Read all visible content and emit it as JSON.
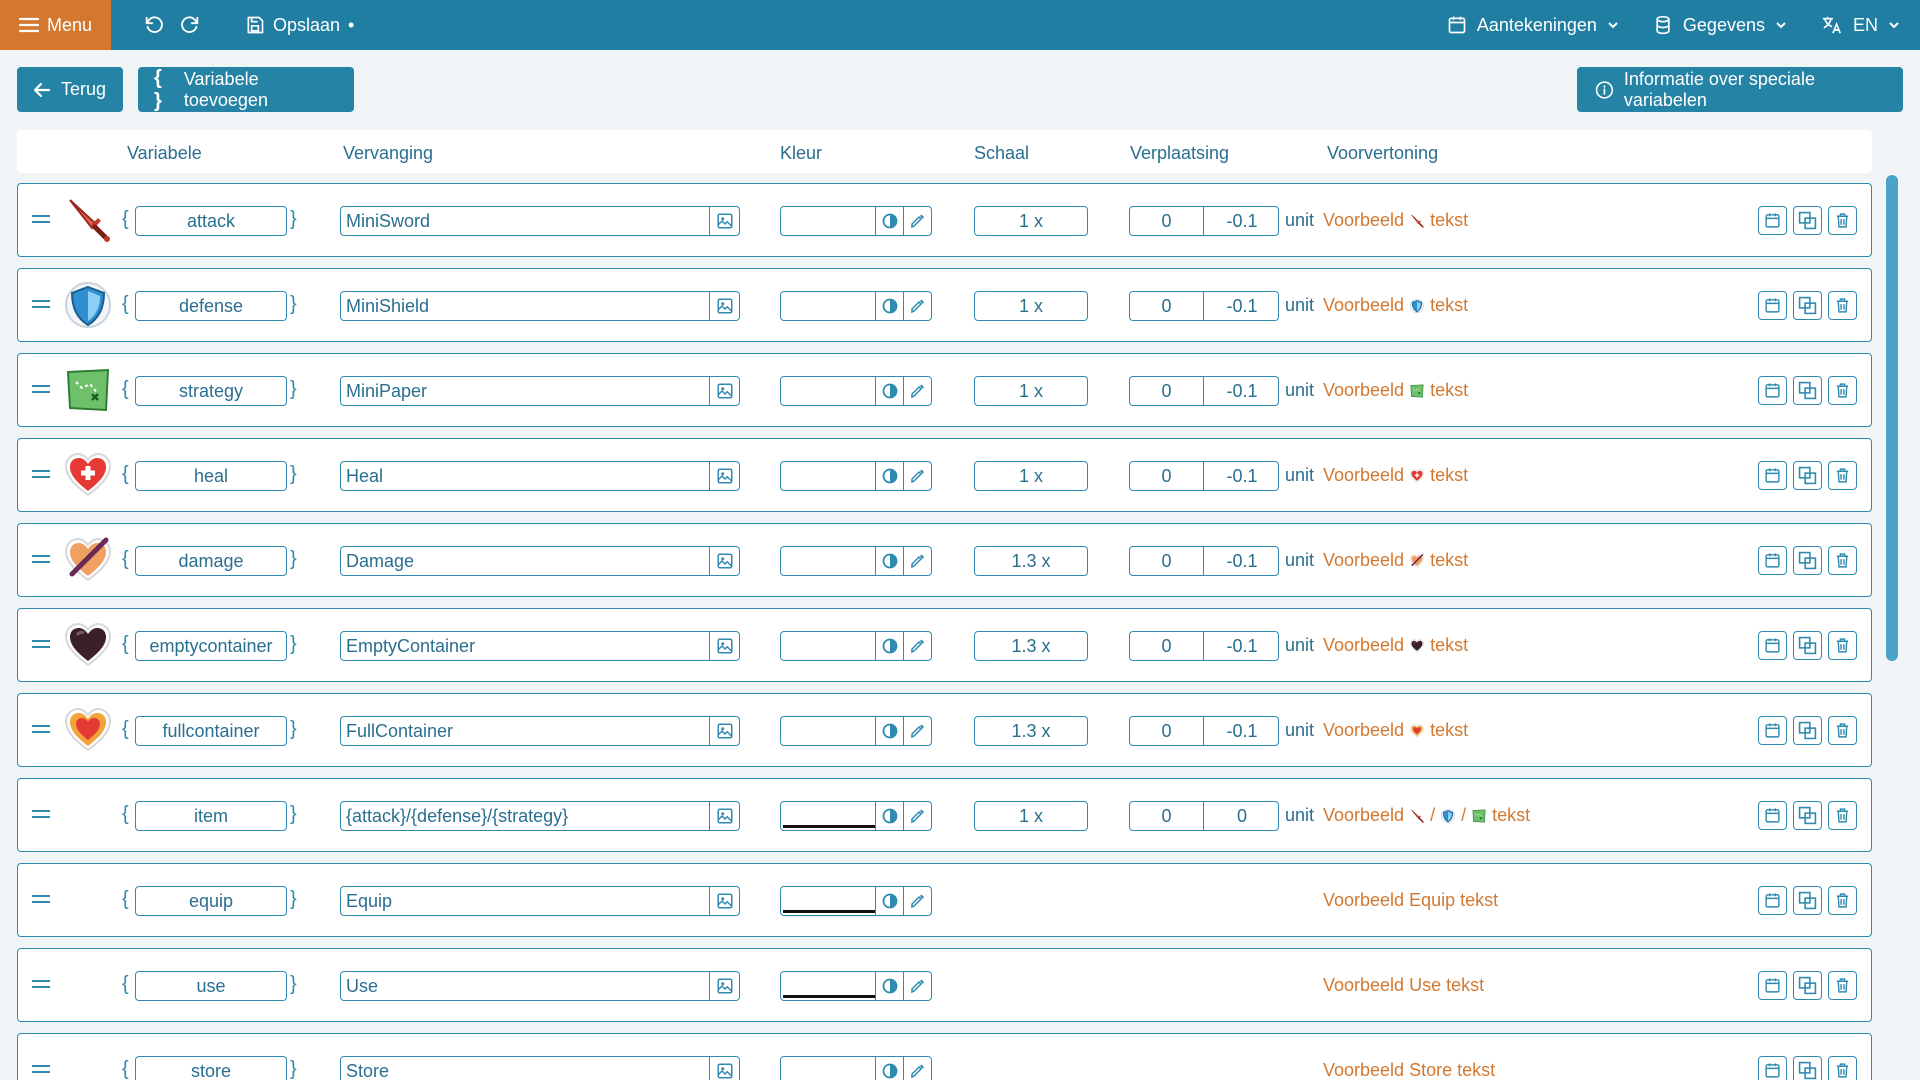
{
  "topbar": {
    "menu_label": "Menu",
    "save_label": "Opslaan",
    "unsaved_marker": "•",
    "notes_label": "Aantekeningen",
    "data_label": "Gegevens",
    "language_label": "EN"
  },
  "actions": {
    "back_label": "Terug",
    "add_label": "Variabele toevoegen",
    "info_label": "Informatie over speciale variabelen"
  },
  "columns": {
    "variable": "Variabele",
    "replacement": "Vervanging",
    "color": "Kleur",
    "scale": "Schaal",
    "offset": "Verplaatsing",
    "preview": "Voorvertoning"
  },
  "preview": {
    "prefix": "Voorbeeld",
    "suffix": "tekst",
    "unit": "unit"
  },
  "rows": [
    {
      "name": "attack",
      "replacement": "MiniSword",
      "scale": "1 x",
      "offset_x": "0",
      "offset_y": "-0.1",
      "icon": "sword-icon"
    },
    {
      "name": "defense",
      "replacement": "MiniShield",
      "scale": "1 x",
      "offset_x": "0",
      "offset_y": "-0.1",
      "icon": "shield-icon"
    },
    {
      "name": "strategy",
      "replacement": "MiniPaper",
      "scale": "1 x",
      "offset_x": "0",
      "offset_y": "-0.1",
      "icon": "map-icon"
    },
    {
      "name": "heal",
      "replacement": "Heal",
      "scale": "1 x",
      "offset_x": "0",
      "offset_y": "-0.1",
      "icon": "heart-cross-icon"
    },
    {
      "name": "damage",
      "replacement": "Damage",
      "scale": "1.3 x",
      "offset_x": "0",
      "offset_y": "-0.1",
      "icon": "slashed-heart-icon"
    },
    {
      "name": "emptycontainer",
      "replacement": "EmptyContainer",
      "scale": "1.3 x",
      "offset_x": "0",
      "offset_y": "-0.1",
      "icon": "empty-heart-icon"
    },
    {
      "name": "fullcontainer",
      "replacement": "FullContainer",
      "scale": "1.3 x",
      "offset_x": "0",
      "offset_y": "-0.1",
      "icon": "full-heart-icon"
    },
    {
      "name": "item",
      "replacement": "{attack}/{defense}/{strategy}",
      "scale": "1 x",
      "offset_x": "0",
      "offset_y": "0",
      "separator": "/"
    },
    {
      "name": "equip",
      "replacement": "Equip",
      "preview_text": "Voorbeeld Equip tekst"
    },
    {
      "name": "use",
      "replacement": "Use",
      "preview_text": "Voorbeeld Use tekst"
    },
    {
      "name": "store",
      "replacement": "Store",
      "preview_text": "Voorbeeld Store tekst"
    }
  ],
  "colors": {
    "topbar": "#1f7ea1",
    "menu": "#d4782f",
    "accent": "#2f8ab0",
    "preview_text": "#d4782f"
  }
}
